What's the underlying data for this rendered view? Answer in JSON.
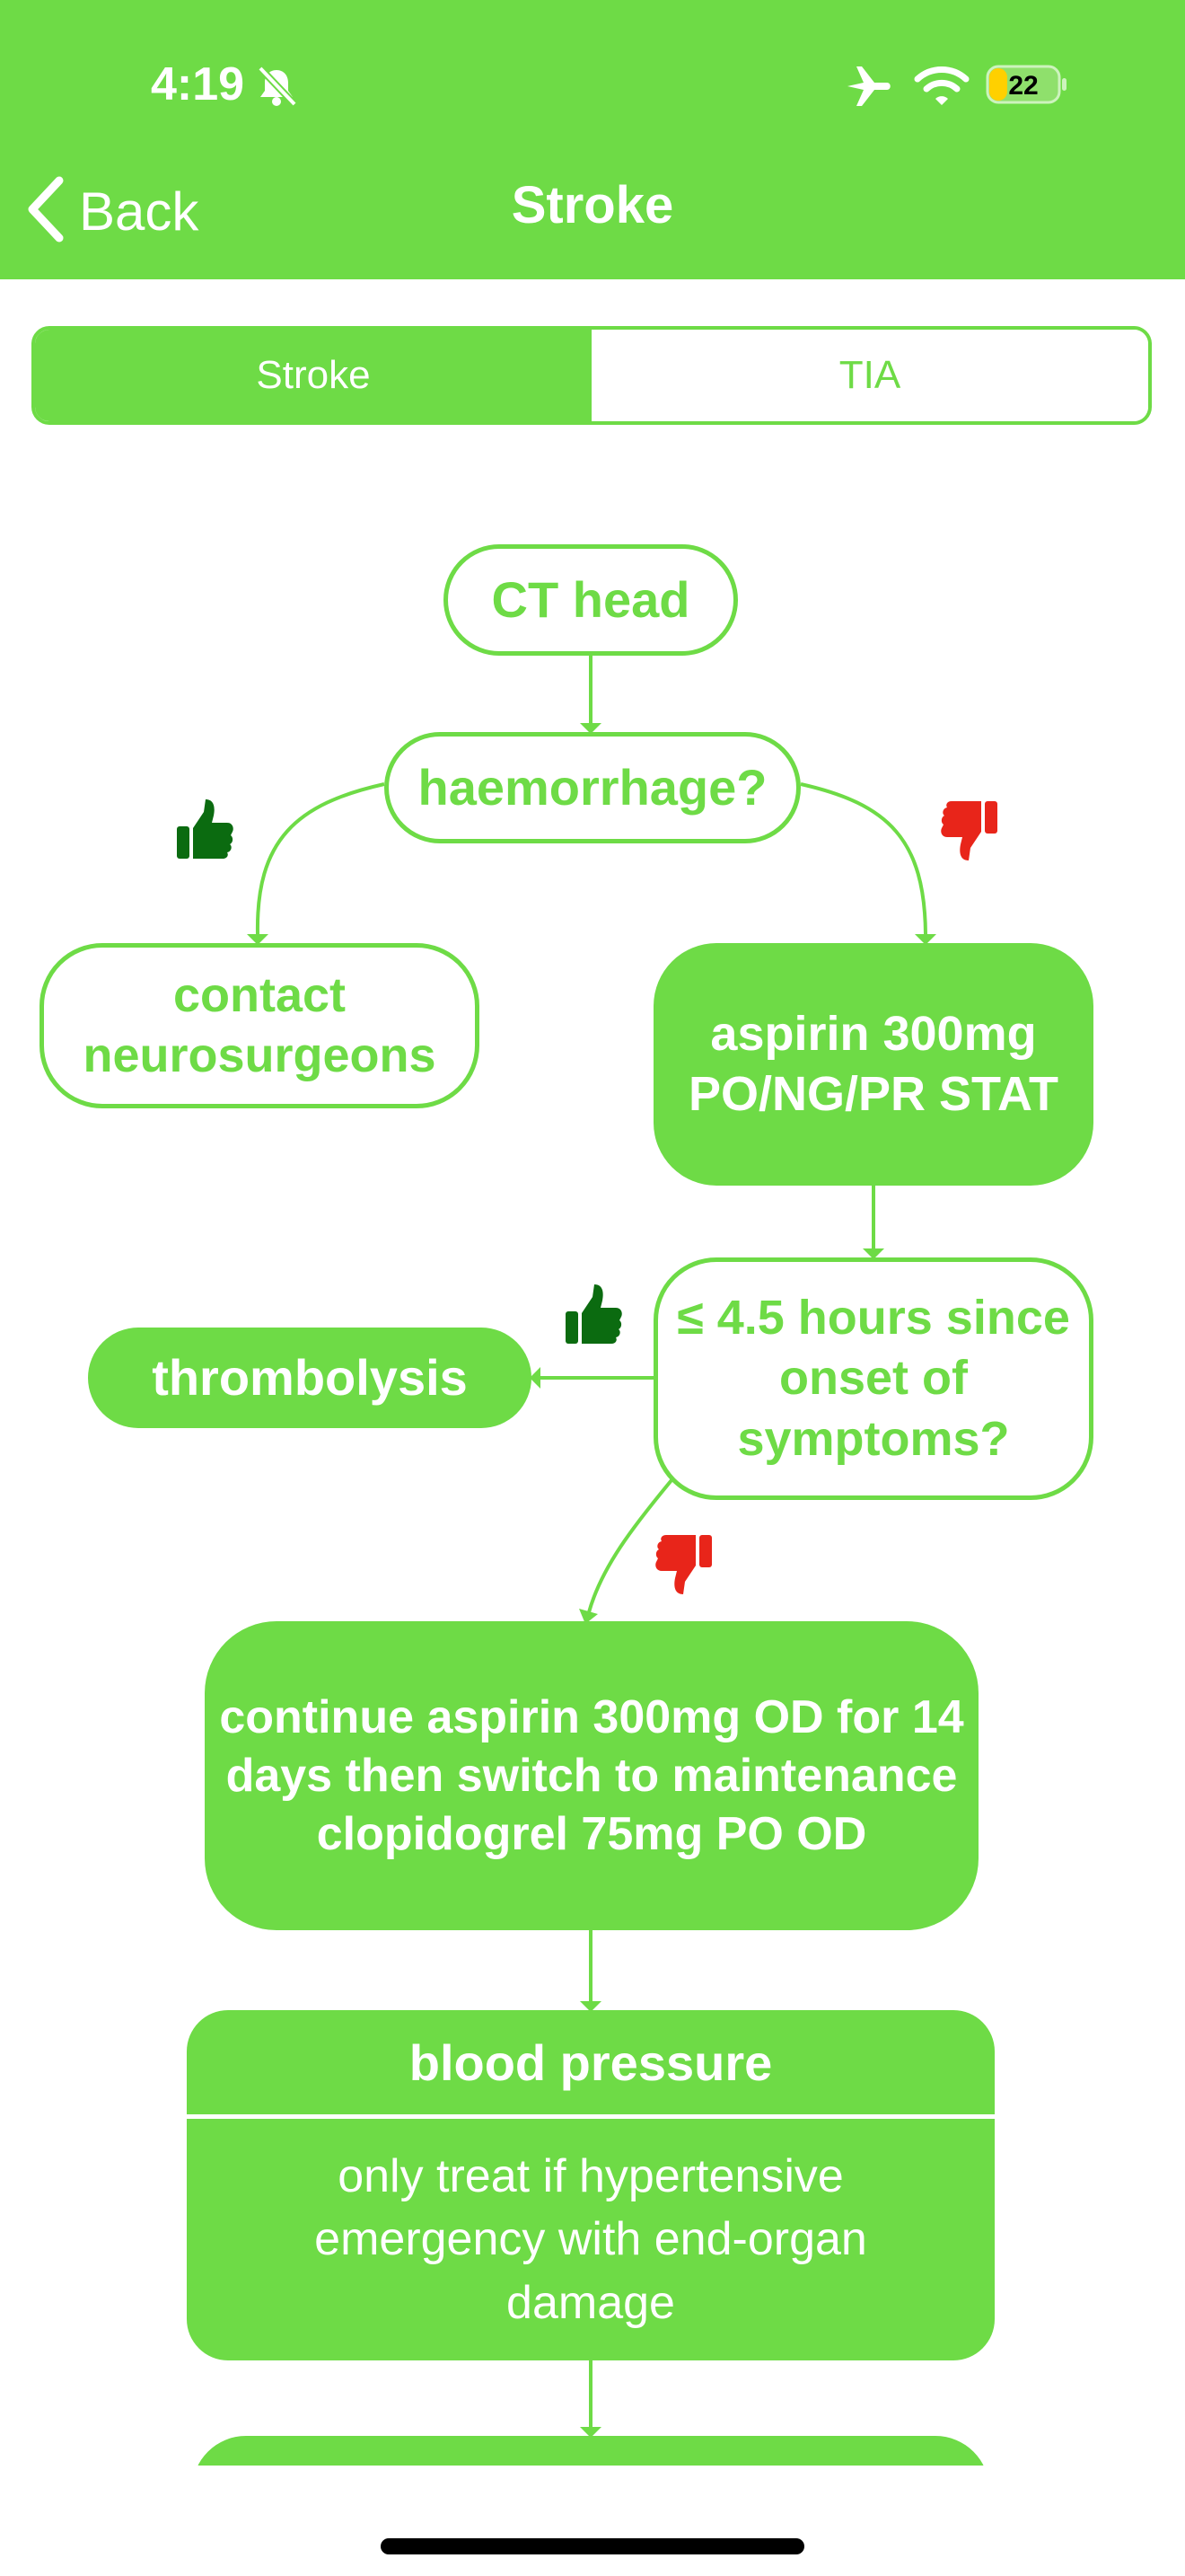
{
  "status_bar": {
    "time": "4:19",
    "battery": "22",
    "icons": [
      "bell-slash-icon",
      "airplane-icon",
      "wifi-icon",
      "battery-icon"
    ]
  },
  "nav": {
    "back_label": "Back",
    "title": "Stroke"
  },
  "tabs": [
    {
      "label": "Stroke",
      "selected": true
    },
    {
      "label": "TIA",
      "selected": false
    }
  ],
  "flow": {
    "ct_head": "CT head",
    "haemorrhage": "haemorrhage?",
    "contact": "contact neurosurgeons",
    "aspirin": "aspirin 300mg PO/NG/PR STAT",
    "hours": "≤ 4.5 hours since onset of symptoms?",
    "thrombolysis": "thrombolysis",
    "continue": "continue aspirin 300mg OD for 14 days then switch to maintenance clopidogrel 75mg PO OD",
    "bp_title": "blood pressure",
    "bp_body": "only treat if hypertensive emergency with end-organ damage"
  },
  "colors": {
    "primary": "#6edb46",
    "thumb_up": "#0b6b10",
    "thumb_down": "#e8251a",
    "background": "#ffffff"
  }
}
